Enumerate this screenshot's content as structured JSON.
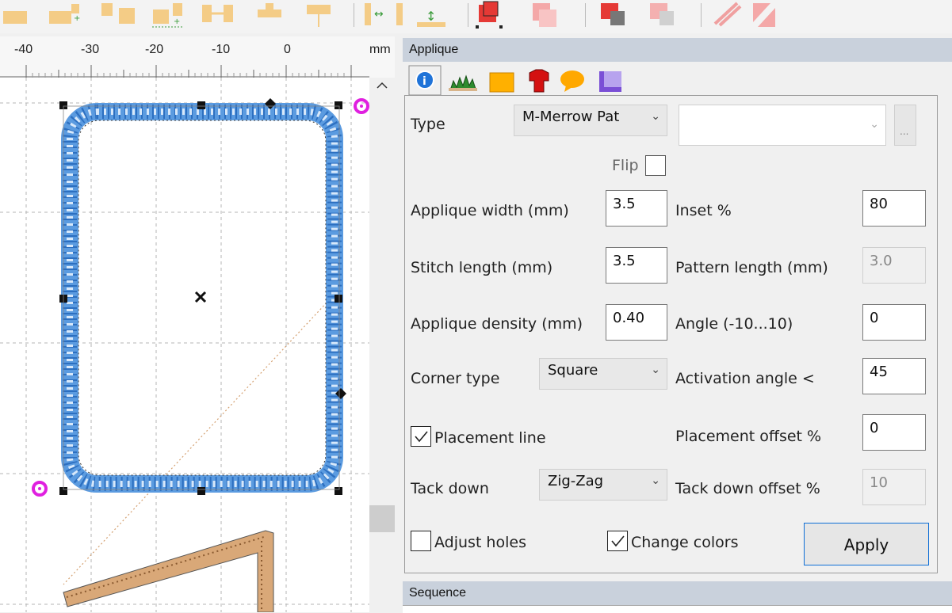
{
  "toolbar": {
    "icons": [
      "align-left-icon",
      "align-bottom-icon",
      "align-top-icon",
      "align-center-icon",
      "align-middle-icon",
      "align-pin-icon",
      "space-horizontal-icon",
      "space-vertical-icon",
      "group-icon",
      "ungroup-icon",
      "bring-front-icon",
      "send-back-icon",
      "clip-icon",
      "fill-icon"
    ]
  },
  "ruler": {
    "labels": [
      "-40",
      "-30",
      "-20",
      "-10",
      "0"
    ],
    "unit": "mm"
  },
  "panel": {
    "title": "Applique",
    "tabs": [
      "info-tab",
      "applique-stitch-tab",
      "fill-tab",
      "clothing-tab",
      "speech-tab",
      "corner-tab"
    ],
    "type_label": "Type",
    "type_value": "M-Merrow Pat",
    "pattern_value": "",
    "browse_label": "...",
    "flip_label": "Flip",
    "flip_checked": false,
    "applique_width_label": "Applique width (mm)",
    "applique_width_value": "3.5",
    "inset_label": "Inset %",
    "inset_value": "80",
    "stitch_length_label": "Stitch length (mm)",
    "stitch_length_value": "3.5",
    "pattern_length_label": "Pattern length (mm)",
    "pattern_length_value": "3.0",
    "density_label": "Applique density (mm)",
    "density_value": "0.40",
    "angle_label": "Angle (-10...10)",
    "angle_value": "0",
    "corner_label": "Corner type",
    "corner_value": "Square",
    "activation_label": "Activation angle <",
    "activation_value": "45",
    "placement_line_label": "Placement line",
    "placement_line_checked": true,
    "placement_offset_label": "Placement offset %",
    "placement_offset_value": "0",
    "tack_label": "Tack down",
    "tack_value": "Zig-Zag",
    "tack_offset_label": "Tack down offset %",
    "tack_offset_value": "10",
    "adjust_holes_label": "Adjust holes",
    "adjust_holes_checked": false,
    "change_colors_label": "Change colors",
    "change_colors_checked": true,
    "apply_label": "Apply"
  },
  "sequence": {
    "title": "Sequence"
  }
}
